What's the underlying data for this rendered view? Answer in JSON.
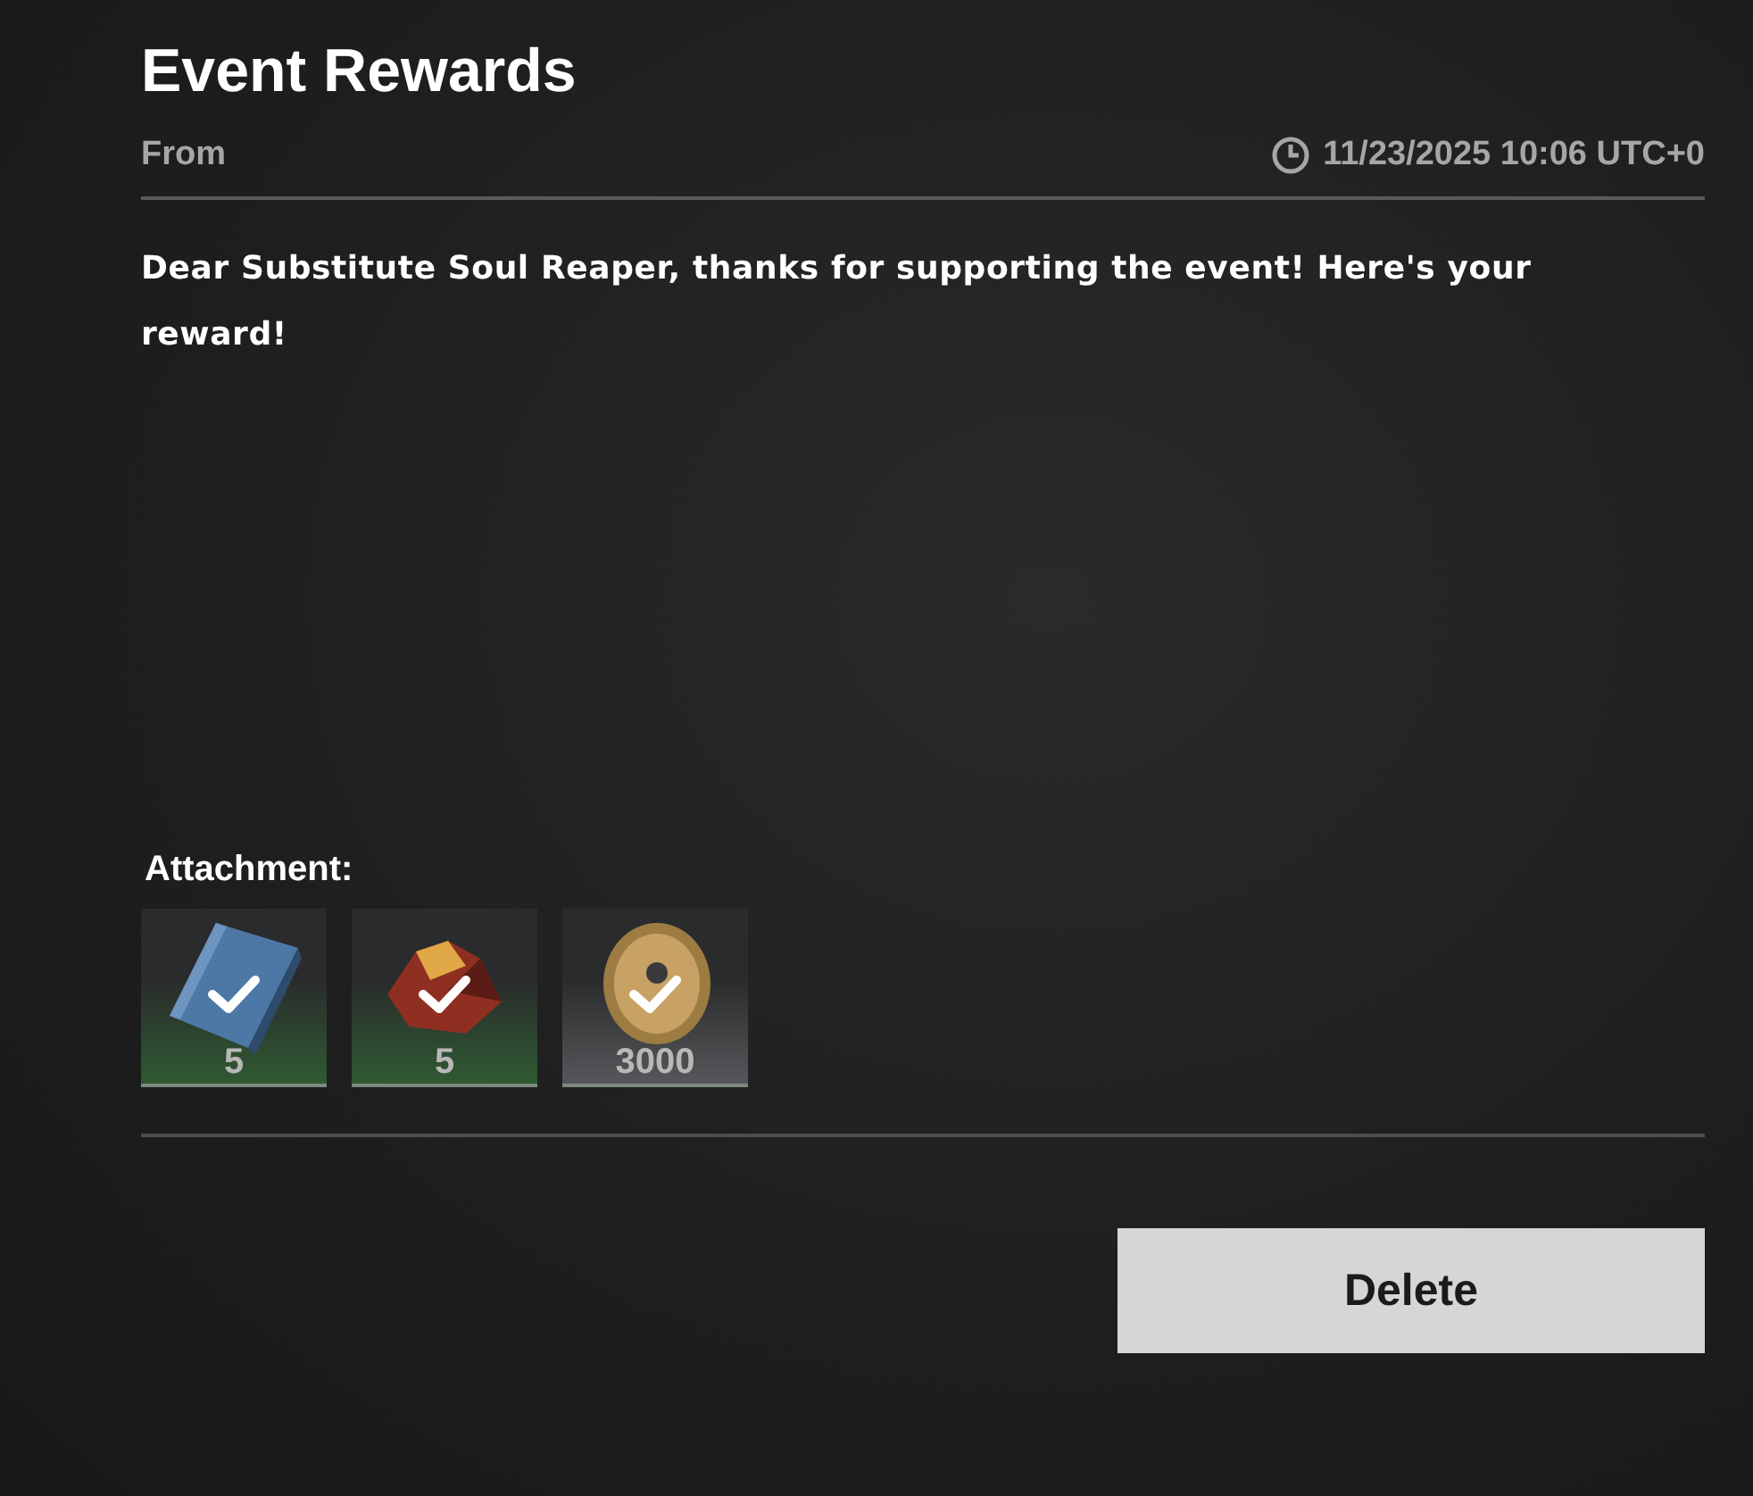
{
  "mail": {
    "title": "Event Rewards",
    "from_label": "From",
    "timestamp": "11/23/2025 10:06 UTC+0",
    "message": "Dear Substitute Soul Reaper, thanks for supporting the event! Here's your reward!"
  },
  "attachments": {
    "label": "Attachment:",
    "items": [
      {
        "kind": "book",
        "count": "5",
        "claimed": true,
        "color": "#2f5a32"
      },
      {
        "kind": "ore",
        "count": "5",
        "claimed": true,
        "color": "#2f5a32"
      },
      {
        "kind": "coin",
        "count": "3000",
        "claimed": true,
        "color": "#55575a"
      }
    ]
  },
  "actions": {
    "delete": "Delete"
  }
}
